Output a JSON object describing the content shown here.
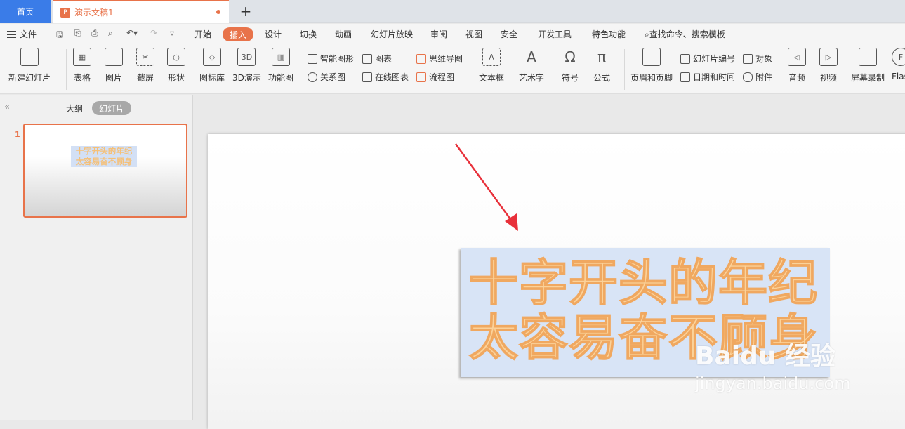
{
  "tabs": {
    "home": "首页",
    "doc": "演示文稿1",
    "add": "+"
  },
  "menu": {
    "file": "文件",
    "items": [
      "开始",
      "插入",
      "设计",
      "切换",
      "动画",
      "幻灯片放映",
      "审阅",
      "视图",
      "安全",
      "开发工具",
      "特色功能"
    ],
    "active": "插入",
    "search": "查找命令、搜索模板"
  },
  "ribbon": {
    "new_slide": "新建幻灯片",
    "table": "表格",
    "picture": "图片",
    "screenshot": "截屏",
    "shape": "形状",
    "icon_lib": "图标库",
    "demo3d": "3D演示",
    "func_chart": "功能图",
    "smart_shape": "智能图形",
    "relation": "关系图",
    "chart": "图表",
    "online_chart": "在线图表",
    "mindmap": "思维导图",
    "flowchart": "流程图",
    "textbox": "文本框",
    "wordart": "艺术字",
    "symbol": "符号",
    "formula": "公式",
    "header_footer": "页眉和页脚",
    "slide_number": "幻灯片编号",
    "datetime": "日期和时间",
    "object": "对象",
    "attachment": "附件",
    "audio": "音频",
    "video": "视频",
    "screen_record": "屏幕录制",
    "flash": "Flash"
  },
  "leftpane": {
    "outline": "大纲",
    "slides": "幻灯片",
    "slide_number": "1",
    "thumb_line1": "十字开头的年纪",
    "thumb_line2": "太容易奋不顾身"
  },
  "slide": {
    "line1": "十字开头的年纪",
    "line2": "太容易奋不顾身"
  },
  "watermark": {
    "main": "Baidu 经验",
    "sub": "jingyan.baidu.com"
  },
  "colors": {
    "accent": "#e8734a",
    "home_tab": "#3a7ce8",
    "text_fill": "#fbd29a",
    "textbox_bg": "#d8e4f6",
    "arrow": "#e8303a"
  }
}
